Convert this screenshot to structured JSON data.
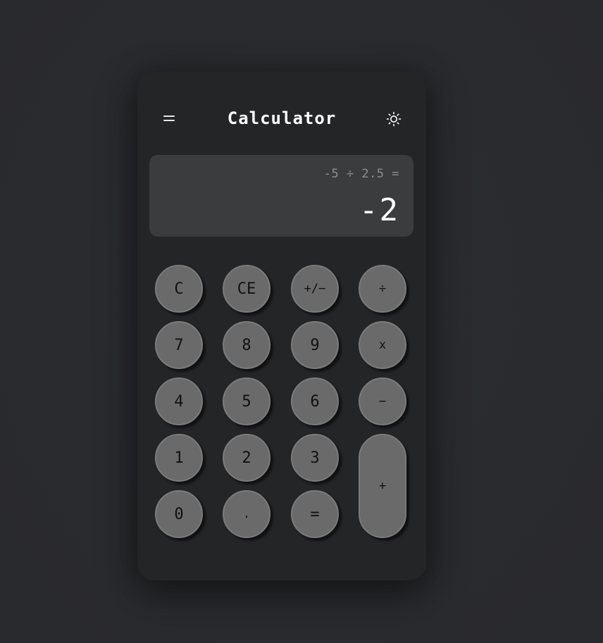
{
  "header": {
    "title": "Calculator",
    "menu_icon": "hamburger-menu-icon",
    "theme_icon": "sun-icon"
  },
  "display": {
    "expression": "-5 ÷ 2.5 =",
    "result": "-2"
  },
  "keys": {
    "clear": "C",
    "clear_entry": "CE",
    "negate": "+/−",
    "divide": "÷",
    "seven": "7",
    "eight": "8",
    "nine": "9",
    "multiply": "x",
    "four": "4",
    "five": "5",
    "six": "6",
    "minus": "−",
    "one": "1",
    "two": "2",
    "three": "3",
    "plus": "+",
    "zero": "0",
    "decimal": ".",
    "equals": "="
  },
  "colors": {
    "background": "#2b2c30",
    "panel": "#242527",
    "display": "#3b3c3e",
    "button": "#6a6a6a",
    "button_border": "#7b7b7b",
    "text_primary": "#ffffff",
    "text_secondary": "#8e8e8e"
  }
}
